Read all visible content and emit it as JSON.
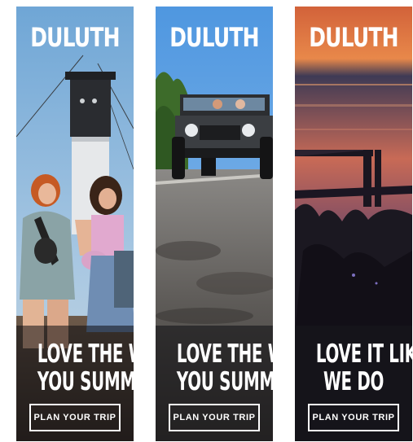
{
  "brand": "DULUTH",
  "banners": [
    {
      "headline_line1": "LOVE THE WAY",
      "headline_line2": "YOU SUMMER",
      "cta_label": "PLAN YOUR TRIP"
    },
    {
      "headline_line1": "LOVE THE WAY",
      "headline_line2": "YOU SUMMER",
      "cta_label": "PLAN YOUR TRIP"
    },
    {
      "headline_line1": "LOVE IT LIKE",
      "headline_line2": "WE DO",
      "cta_label": "PLAN YOUR TRIP"
    }
  ],
  "colors": {
    "text": "#ffffff",
    "panel_dark": "#15141a",
    "sky_blue": "#7fb2dc",
    "sunset_orange": "#e0703a"
  }
}
